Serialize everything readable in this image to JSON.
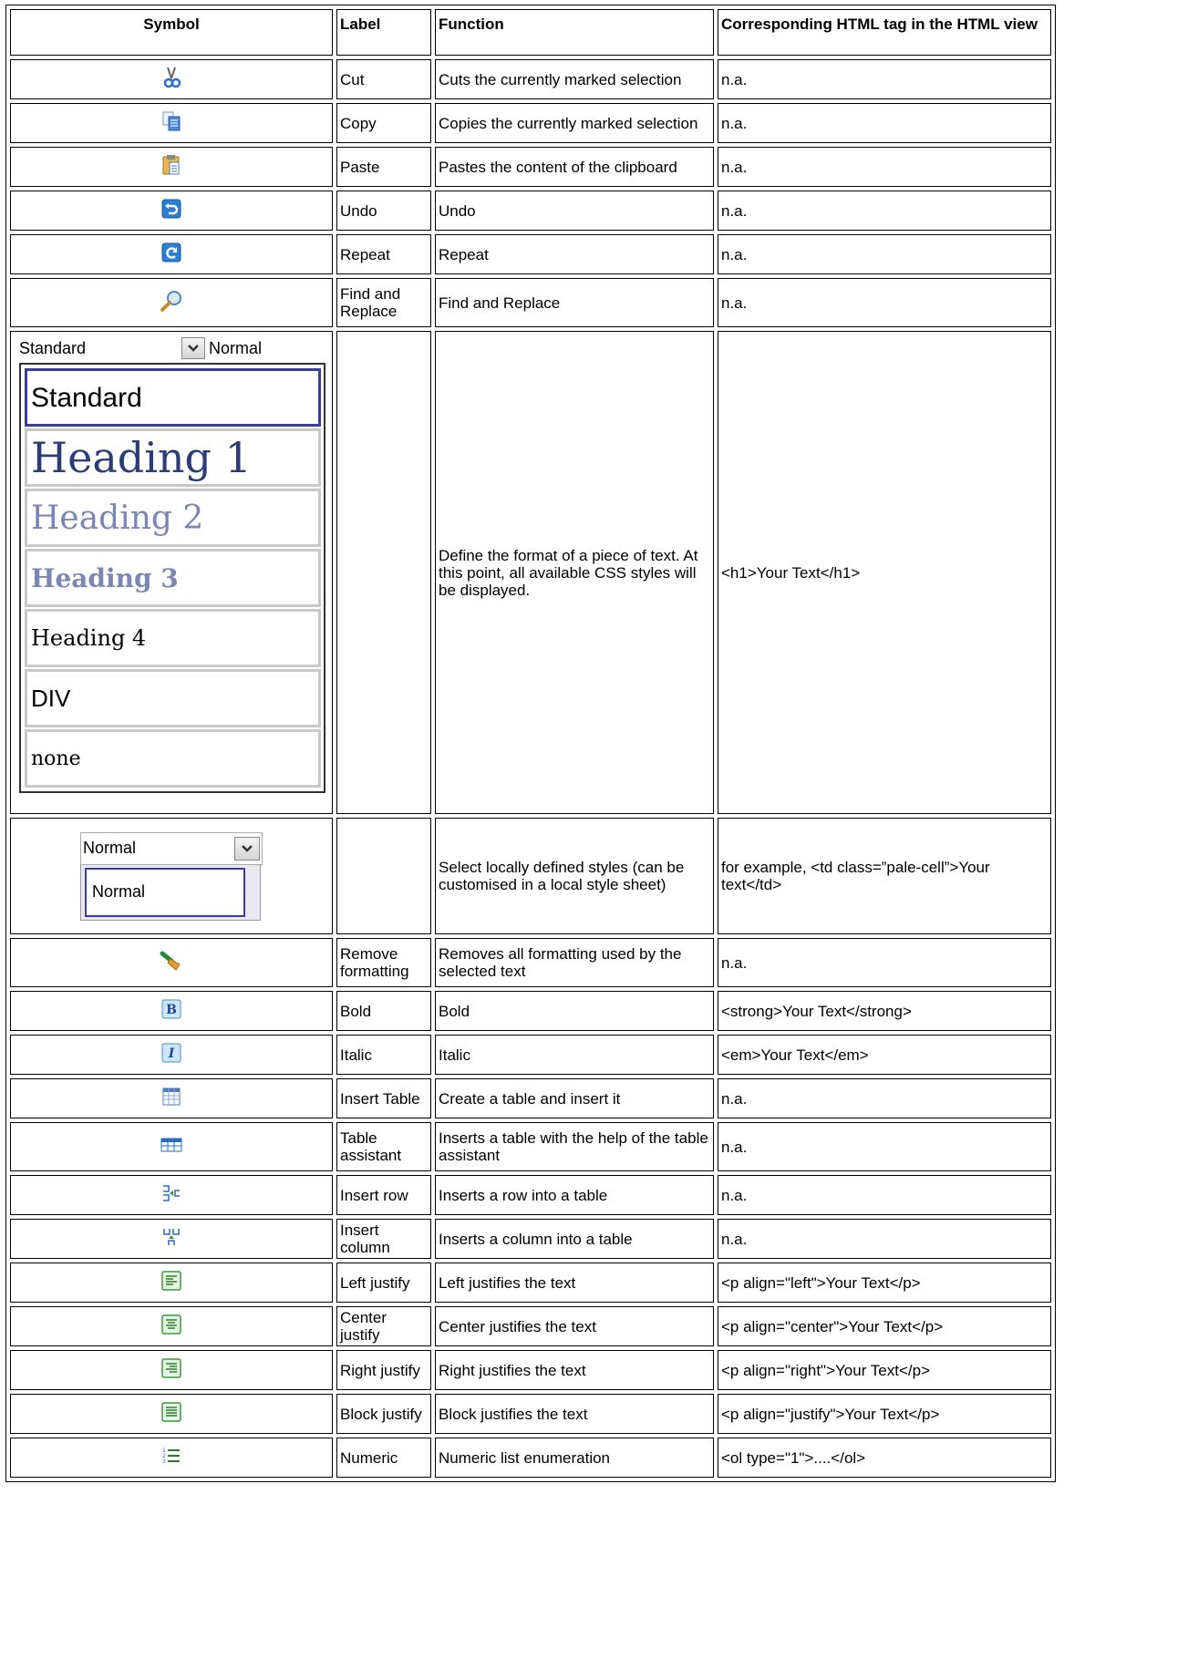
{
  "headers": {
    "symbol": "Symbol",
    "label": "Label",
    "function": "Function",
    "tag": "Corresponding HTML tag in the HTML view"
  },
  "rows": [
    {
      "icon": "scissors-icon",
      "label": "Cut",
      "function": "Cuts the currently marked selection",
      "tag": "n.a."
    },
    {
      "icon": "copy-icon",
      "label": "Copy",
      "function": "Copies the currently marked selection",
      "tag": "n.a."
    },
    {
      "icon": "paste-icon",
      "label": "Paste",
      "function": "Pastes the content of the clipboard",
      "tag": "n.a."
    },
    {
      "icon": "undo-icon",
      "label": "Undo",
      "function": "Undo",
      "tag": "n.a."
    },
    {
      "icon": "redo-icon",
      "label": "Repeat",
      "function": "Repeat",
      "tag": "n.a."
    },
    {
      "icon": "magnifier-icon",
      "label": "Find and Replace",
      "function": "Find and Replace",
      "tag": "n.a."
    },
    {
      "icon": "style-dropdown",
      "label": "",
      "function": "Define the format of a piece of text.  At this point, all available CSS styles will be displayed.",
      "tag": "<h1>Your Text</h1>"
    },
    {
      "icon": "local-style-dropdown",
      "label": "",
      "function": "Select locally defined styles (can be customised in a local style sheet)",
      "tag": "for example, <td class=”pale-cell”>Your text</td>"
    },
    {
      "icon": "brush-icon",
      "label": "Remove formatting",
      "function": "Removes all formatting used by the selected text",
      "tag": "n.a."
    },
    {
      "icon": "bold-icon",
      "label": "Bold",
      "function": "Bold",
      "tag": "<strong>Your Text</strong>"
    },
    {
      "icon": "italic-icon",
      "label": "Italic",
      "function": "Italic",
      "tag": "<em>Your Text</em>"
    },
    {
      "icon": "table-icon",
      "label": "Insert Table",
      "function": "Create a table and insert it",
      "tag": "n.a."
    },
    {
      "icon": "table-assistant-icon",
      "label": "Table assistant",
      "function": "Inserts a table with the help of the table assistant",
      "tag": "n.a."
    },
    {
      "icon": "insert-row-icon",
      "label": "Insert row",
      "function": "Inserts a row into a table",
      "tag": "n.a."
    },
    {
      "icon": "insert-column-icon",
      "label": "Insert column",
      "function": "Inserts a column into a table",
      "tag": "n.a."
    },
    {
      "icon": "align-left-icon",
      "label": "Left justify",
      "function": "Left justifies the text",
      "tag": "<p align=\"left\">Your Text</p>"
    },
    {
      "icon": "align-center-icon",
      "label": "Center justify",
      "function": "Center justifies the text",
      "tag": "<p align=\"center\">Your Text</p>"
    },
    {
      "icon": "align-right-icon",
      "label": "Right justify",
      "function": "Right justifies the text",
      "tag": "<p align=\"right\">Your Text</p>"
    },
    {
      "icon": "align-justify-icon",
      "label": "Block justify",
      "function": "Block justifies the text",
      "tag": "<p align=\"justify\">Your Text</p>"
    },
    {
      "icon": "numbered-list-icon",
      "label": "Numeric",
      "function": "Numeric list enumeration",
      "tag": "<ol type=\"1\">....</ol>"
    }
  ],
  "style_dropdown": {
    "selected": "Standard",
    "second_selected": "Normal",
    "options": [
      "Standard",
      "Heading 1",
      "Heading 2",
      "Heading 3",
      "Heading 4",
      "DIV",
      "none"
    ]
  },
  "local_dropdown": {
    "selected": "Normal",
    "options": [
      "Normal"
    ]
  },
  "colors": {
    "border": "#000000",
    "selection": "#3c3ca0",
    "icon_blue": "#2a7fd4",
    "icon_green": "#3a9a3a"
  }
}
